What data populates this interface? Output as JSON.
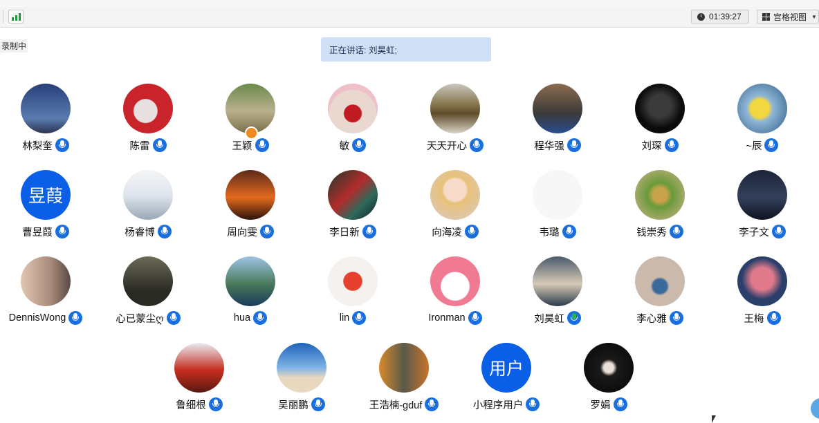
{
  "toolbar": {
    "timer": "01:39:27",
    "view_label": "宫格视图",
    "signal_icon": "signal-bars-icon",
    "clock_icon": "clock-icon",
    "grid_icon": "grid-view-icon"
  },
  "recording_label": "录制中",
  "speaking": "正在讲话: 刘昊虹;",
  "colors": {
    "mic": "#1a6fe0",
    "speaking_bg": "#cfe0f6",
    "avatar_text": "#0a5fe6"
  },
  "participants": [
    {
      "name": "林梨奎",
      "avatar_text": "",
      "bg": "linear-gradient(#27407a,#5b7bb0 70%,#2a3350)"
    },
    {
      "name": "陈雷",
      "avatar_text": "",
      "bg": "radial-gradient(circle at 45% 55%,#e8e0e0 0 30%,#c9232b 32%)"
    },
    {
      "name": "王颖",
      "avatar_text": "",
      "bg": "linear-gradient(#6b8a4a,#b9b08e 55%,#7a6e4a)"
    },
    {
      "name": "敏",
      "avatar_text": "",
      "bg": "radial-gradient(circle at 50% 60%,#c01a22 0 22%,#e9d8d0 24% 60%,#efc0c8 62%)"
    },
    {
      "name": "天天开心",
      "avatar_text": "",
      "bg": "linear-gradient(#c9c7bf,#8a7a52 40%,#5f4b2a 60%,#d8d3c6)"
    },
    {
      "name": "程华强",
      "avatar_text": "",
      "bg": "linear-gradient(#8b6b4e,#3a3a3a 60%,#2a4d8f)"
    },
    {
      "name": "刘琛",
      "avatar_text": "",
      "bg": "radial-gradient(circle at 50% 45%,#3a3a3a 0 30%,#0a0a0a 60%)"
    },
    {
      "name": "~辰",
      "avatar_text": "",
      "bg": "radial-gradient(circle at 45% 50%,#f2d740 0 25%,#8fb6d6 35%,#2d5d87)"
    },
    {
      "name": "曹昱葭",
      "avatar_text": "昱葭",
      "bg": "#0a5fe6"
    },
    {
      "name": "杨睿博",
      "avatar_text": "",
      "bg": "linear-gradient(#f4f4f4,#dfe6ee 50%,#9aa7b5)"
    },
    {
      "name": "周向雯",
      "avatar_text": "",
      "bg": "linear-gradient(#5a2a1a,#e46a1e 55%,#2a1208)"
    },
    {
      "name": "李日新",
      "avatar_text": "",
      "bg": "linear-gradient(135deg,#1d3a2a,#b22b2b 45%,#2d6a5a 70%,#101a2a)"
    },
    {
      "name": "向海凌",
      "avatar_text": "",
      "bg": "radial-gradient(circle at 50% 40%,#f6dcc8 0 28%,#e8c27a 34%,#d9c9c2)"
    },
    {
      "name": "韦璐",
      "avatar_text": "",
      "bg": "#f7f7f7"
    },
    {
      "name": "钱崇秀",
      "avatar_text": "",
      "bg": "radial-gradient(circle at 50% 50%,#c9a34a 0 20%,#6a9a3a 35%,#d2b48c)"
    },
    {
      "name": "李子文",
      "avatar_text": "",
      "bg": "linear-gradient(#1c2438,#34405c 55%,#0e1220)"
    },
    {
      "name": "DennisWong",
      "avatar_text": "",
      "bg": "linear-gradient(90deg,#e2c6b2,#a88a7a 60%,#5a4a44)"
    },
    {
      "name": "心已蒙尘ღ",
      "avatar_text": "",
      "bg": "linear-gradient(#6b6a58,#2a2a24 70%)"
    },
    {
      "name": "hua",
      "avatar_text": "",
      "bg": "linear-gradient(#9ec4e6,#4a7a5a 55%,#1a3a5a)"
    },
    {
      "name": "lin",
      "avatar_text": "",
      "bg": "radial-gradient(circle at 50% 50%,#e8402e 0 26%,#f4f1ee 28%)"
    },
    {
      "name": "Ironman",
      "avatar_text": "",
      "bg": "radial-gradient(circle at 50% 60%,#ffffff 0 36%,#f07a92 38%)"
    },
    {
      "name": "刘昊虹",
      "avatar_text": "",
      "bg": "linear-gradient(#4a5a6a,#d6c9b6 55%,#2a3a4a)"
    },
    {
      "name": "李心雅",
      "avatar_text": "",
      "bg": "radial-gradient(circle at 50% 60%,#3a6a9a 0 18%,#cbb9ac 24%)"
    },
    {
      "name": "王梅",
      "avatar_text": "",
      "bg": "radial-gradient(circle at 50% 45%,#e07a8a 0 30%,#2a3f6a 55%)"
    },
    {
      "name": "鲁细根",
      "avatar_text": "",
      "bg": "linear-gradient(#e8eef4,#c62d1e 55%,#5a1a12)"
    },
    {
      "name": "吴丽鹏",
      "avatar_text": "",
      "bg": "linear-gradient(#1f63b8,#7fb3e6 50%,#e8d8c0 70%)"
    },
    {
      "name": "王浩楠-gduf",
      "avatar_text": "",
      "bg": "linear-gradient(90deg,#d88a2a,#5a5a4a 50%,#c9742a)"
    },
    {
      "name": "小程序用户",
      "avatar_text": "用户",
      "bg": "#0a5fe6"
    },
    {
      "name": "罗娟",
      "avatar_text": "",
      "bg": "radial-gradient(circle at 50% 50%,#e8e0d8 0 14%,#1a1a1a 24%,#050505)"
    }
  ]
}
